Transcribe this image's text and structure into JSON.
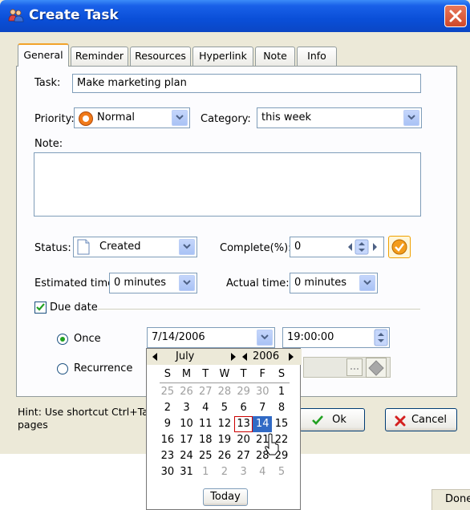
{
  "window": {
    "title": "Create Task"
  },
  "tabs": [
    "General",
    "Reminder",
    "Resources",
    "Hyperlink",
    "Note",
    "Info"
  ],
  "task": {
    "label": "Task:",
    "value": "Make marketing plan"
  },
  "priority": {
    "label": "Priority:",
    "value": "Normal"
  },
  "category": {
    "label": "Category:",
    "value": "this week"
  },
  "note": {
    "label": "Note:",
    "value": ""
  },
  "status": {
    "label": "Status:",
    "value": "Created"
  },
  "complete": {
    "label": "Complete(%):",
    "value": "0"
  },
  "estimated": {
    "label": "Estimated time:",
    "value": "0 minutes"
  },
  "actual": {
    "label": "Actual time:",
    "value": "0 minutes"
  },
  "due": {
    "label": "Due date",
    "checked": true,
    "once_label": "Once",
    "recurrence_label": "Recurrence",
    "date": "7/14/2006",
    "time": "19:00:00"
  },
  "calendar": {
    "month": "July",
    "year": "2006",
    "weekdays": [
      "S",
      "M",
      "T",
      "W",
      "T",
      "F",
      "S"
    ],
    "weeks": [
      [
        "25",
        "26",
        "27",
        "28",
        "29",
        "30",
        "1"
      ],
      [
        "2",
        "3",
        "4",
        "5",
        "6",
        "7",
        "8"
      ],
      [
        "9",
        "10",
        "11",
        "12",
        "13",
        "14",
        "15"
      ],
      [
        "16",
        "17",
        "18",
        "19",
        "20",
        "21",
        "22"
      ],
      [
        "23",
        "24",
        "25",
        "26",
        "27",
        "28",
        "29"
      ],
      [
        "30",
        "31",
        "1",
        "2",
        "3",
        "4",
        "5"
      ]
    ],
    "today_button": "Today"
  },
  "hint": "Hint: Use shortcut Ctrl+Tab\npages",
  "buttons": {
    "ok": "Ok",
    "cancel": "Cancel"
  },
  "status_bar": {
    "done": "Done"
  },
  "colors": {
    "title_bar": "#0a4fd8",
    "selected_day": "#316ac5",
    "tab_highlight": "#f2a32a"
  }
}
